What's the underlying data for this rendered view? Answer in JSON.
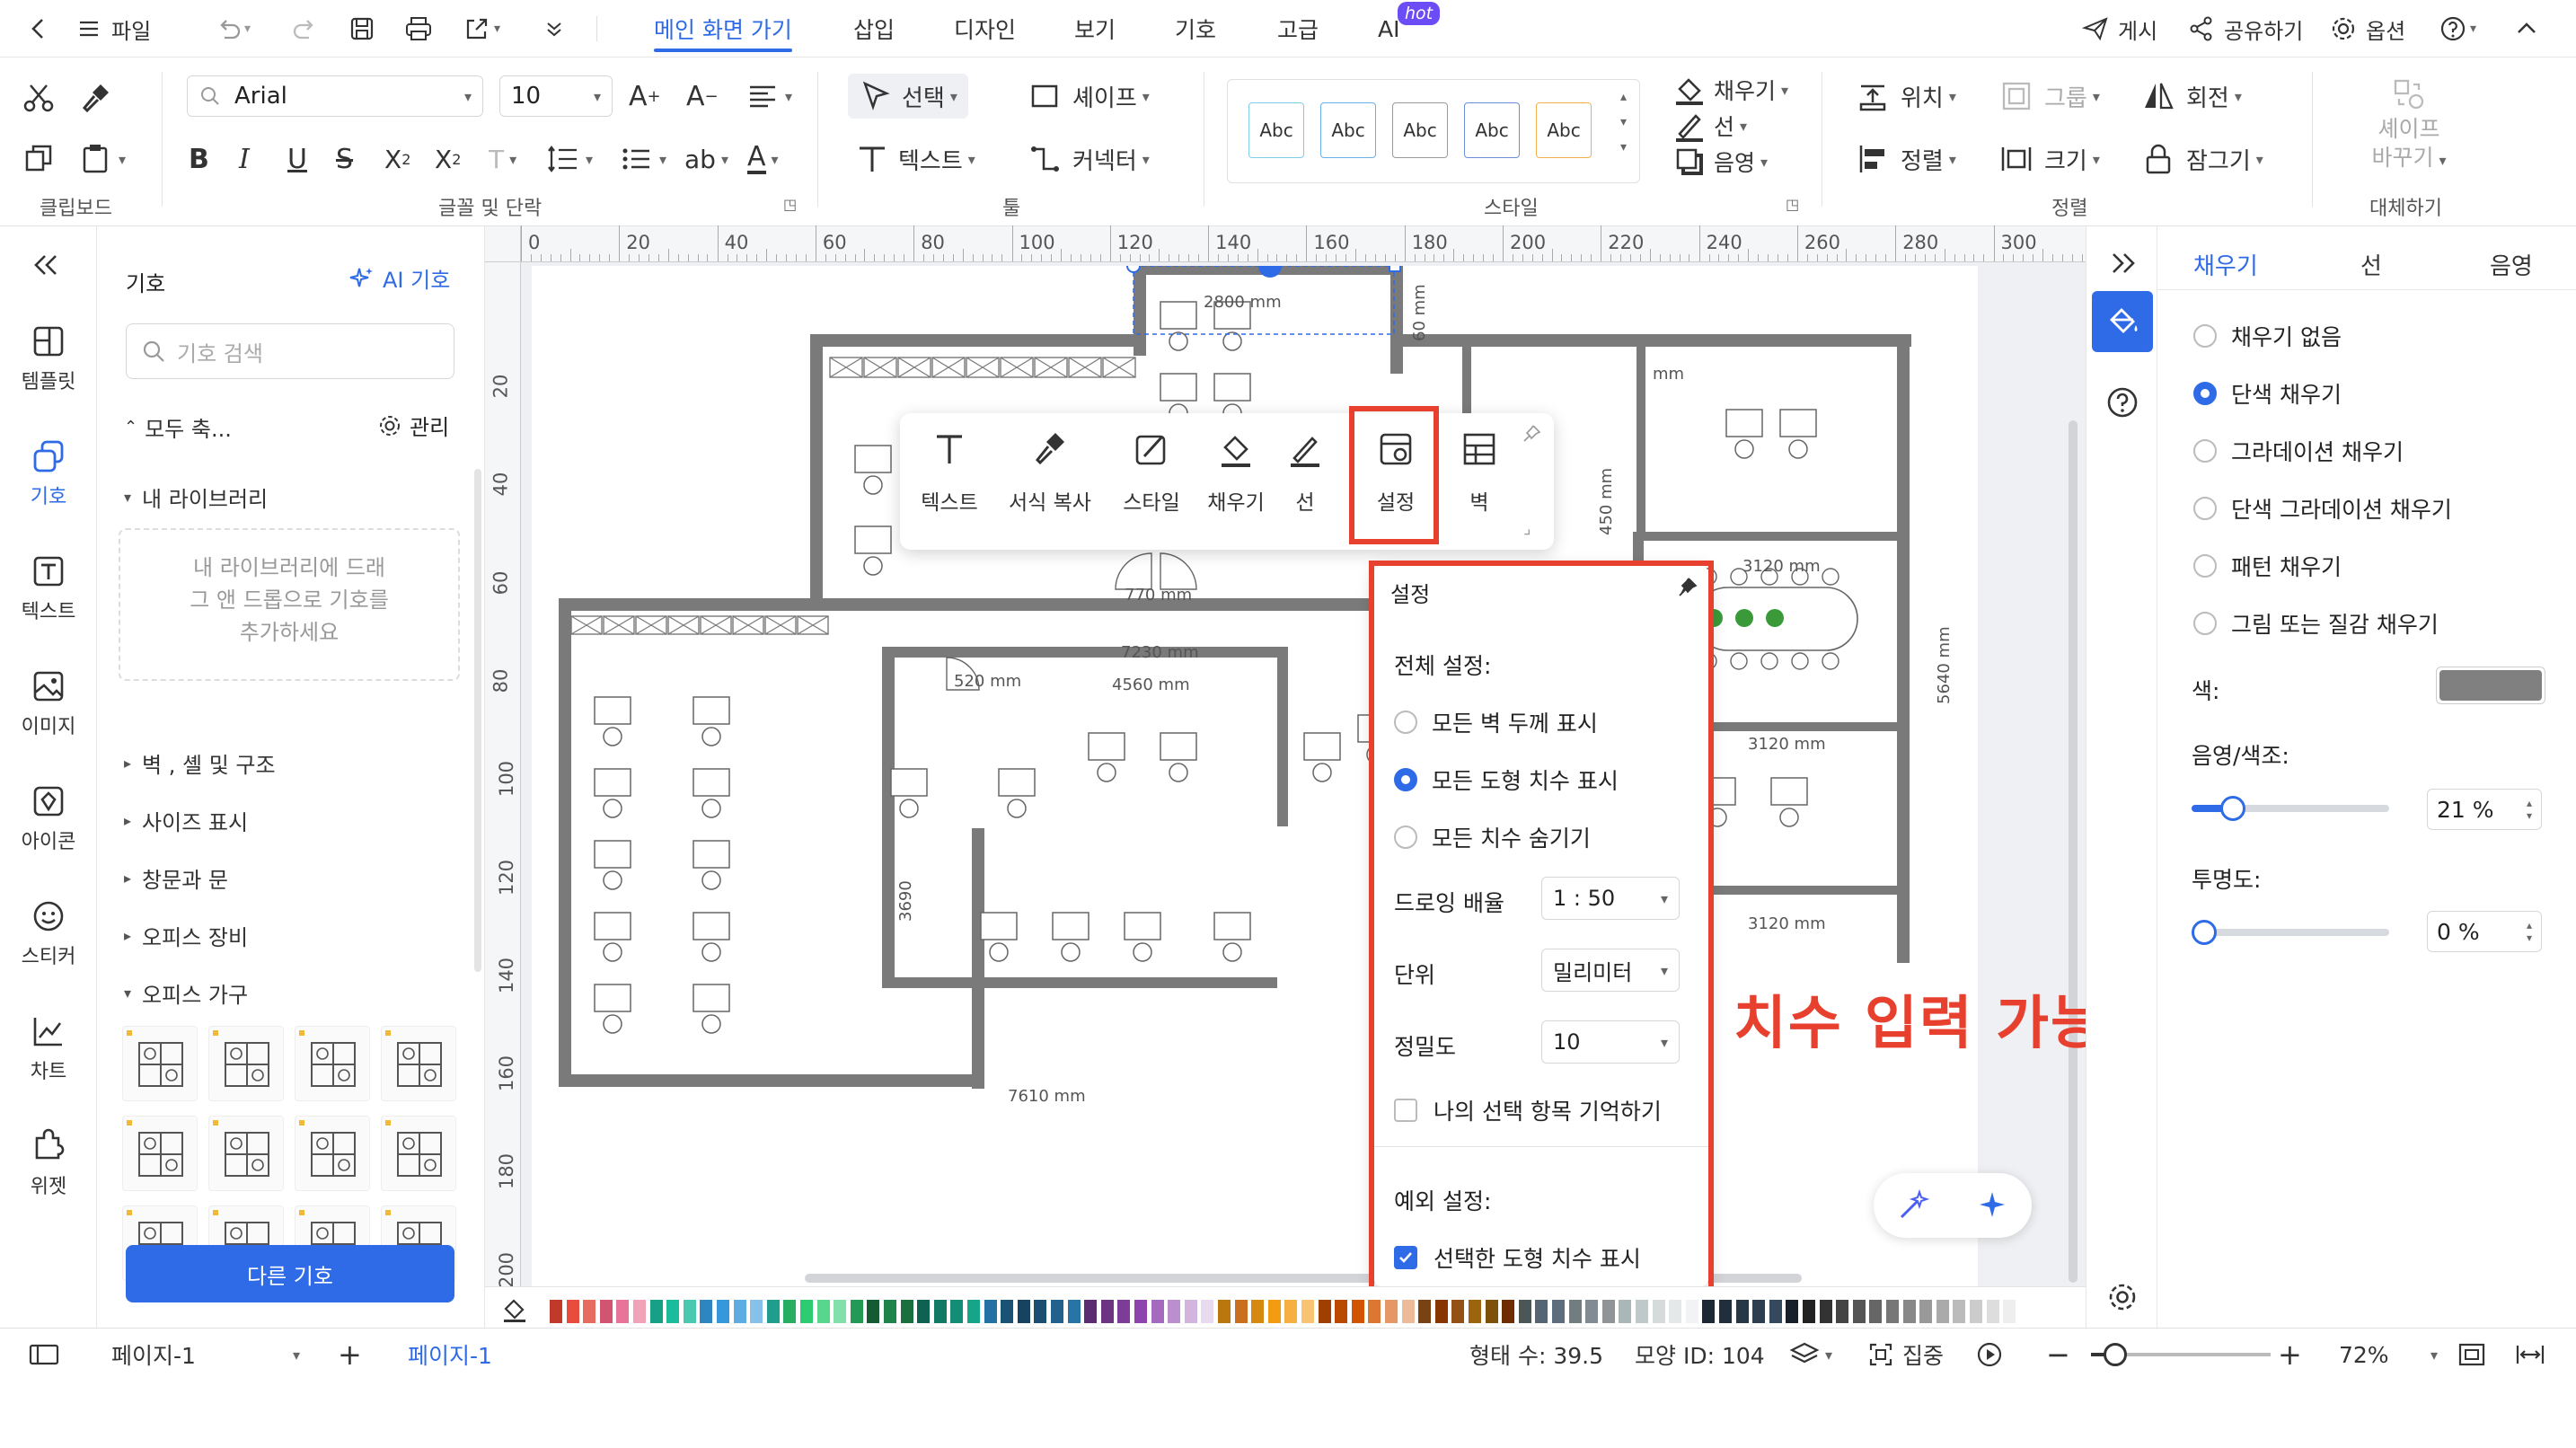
{
  "topbar": {
    "file_label": "파일",
    "tabs": [
      {
        "label": "메인 화면 가기",
        "active": true
      },
      {
        "label": "삽입"
      },
      {
        "label": "디자인"
      },
      {
        "label": "보기"
      },
      {
        "label": "기호"
      },
      {
        "label": "고급"
      },
      {
        "label": "AI"
      }
    ],
    "hot_badge": "hot",
    "post_label": "게시",
    "share_label": "공유하기",
    "options_label": "옵션"
  },
  "ribbon": {
    "font_name": "Arial",
    "font_size": "10",
    "select_label": "선택",
    "shape_label": "셰이프",
    "text_label": "텍스트",
    "connector_label": "커넥터",
    "fill_label": "채우기",
    "line_label": "선",
    "shadow_label": "음영",
    "position_label": "위치",
    "group_label": "그룹",
    "rotate_label": "회전",
    "align_label": "정렬",
    "size_label": "크기",
    "lock_label": "잠그기",
    "replace_shape_label": "셰이프 바꾸기",
    "style_samples": [
      "Abc",
      "Abc",
      "Abc",
      "Abc",
      "Abc"
    ],
    "style_colors": [
      "#7fcfe8",
      "#6ab0e6",
      "#9a9a9a",
      "#6a8fd8",
      "#f2b04a"
    ],
    "groups": {
      "clipboard": "클립보드",
      "font_para": "글꼴 및 단락",
      "tools": "툴",
      "style": "스타일",
      "arrange": "정렬",
      "replace": "대체하기"
    }
  },
  "leftnav": {
    "items": [
      {
        "label": "템플릿",
        "icon": "template-icon"
      },
      {
        "label": "기호",
        "icon": "symbol-icon",
        "active": true
      },
      {
        "label": "텍스트",
        "icon": "text-icon"
      },
      {
        "label": "이미지",
        "icon": "image-icon"
      },
      {
        "label": "아이콘",
        "icon": "icon-icon"
      },
      {
        "label": "스티커",
        "icon": "sticker-icon"
      },
      {
        "label": "차트",
        "icon": "chart-icon"
      },
      {
        "label": "위젯",
        "icon": "widget-icon"
      }
    ]
  },
  "symbols": {
    "title": "기호",
    "ai_symbols": "AI 기호",
    "search_placeholder": "기호 검색",
    "collapse_all": "모두 축...",
    "manage": "관리",
    "my_library": "내 라이브러리",
    "my_library_hint": "내 라이브러리에 드래그 앤 드롭으로 기호를 추가하세요",
    "categories": [
      "벽 , 셸 및 구조",
      "사이즈 표시",
      "창문과 문",
      "오피스 장비",
      "오피스 가구"
    ],
    "more_button": "다른 기호"
  },
  "ruler": {
    "top": [
      "0",
      "20",
      "40",
      "60",
      "80",
      "100",
      "120",
      "140",
      "160",
      "180",
      "200",
      "220",
      "240",
      "260",
      "280",
      "300"
    ],
    "left": [
      "20",
      "40",
      "60",
      "80",
      "100",
      "120",
      "140",
      "160",
      "180",
      "200"
    ]
  },
  "floorplan": {
    "dims": [
      "2800 mm",
      "770 mm",
      "7230 mm",
      "520 mm",
      "4560 mm",
      "3690",
      "7610 mm",
      "3120 mm",
      "3120 mm",
      "3120 mm",
      "5640 mm",
      "450 mm",
      "60 mm",
      "mm"
    ]
  },
  "floatbar": {
    "items": [
      "텍스트",
      "서식 복사",
      "스타일",
      "채우기",
      "선",
      "설정",
      "벽"
    ]
  },
  "settings": {
    "title": "설정",
    "global_heading": "전체 설정:",
    "options": [
      "모든 벽 두께 표시",
      "모든 도형 치수 표시",
      "모든 치수 숨기기"
    ],
    "selected_option": 1,
    "scale_label": "드로잉 배율",
    "scale_value": "1 : 50",
    "unit_label": "단위",
    "unit_value": "밀리미터",
    "precision_label": "정밀도",
    "precision_value": "10",
    "remember_label": "나의 선택 항목 기억하기",
    "exception_heading": "예외 설정:",
    "exception_label": "선택한 도형 치수 표시"
  },
  "annotation": "치수 입력 가능",
  "rightpanel": {
    "tabs": [
      "채우기",
      "선",
      "음영"
    ],
    "fill_options": [
      "채우기 없음",
      "단색 채우기",
      "그라데이션 채우기",
      "단색 그라데이션 채우기",
      "패턴 채우기",
      "그림 또는 질감 채우기"
    ],
    "selected_fill": 1,
    "color_label": "색:",
    "color_value": "#808080",
    "tint_label": "음영/색조:",
    "tint_value": "21 %",
    "tint_level": 21,
    "transparency_label": "투명도:",
    "transparency_value": "0 %",
    "transparency_level": 0
  },
  "statusbar": {
    "page_select": "페이지-1",
    "page_tab": "페이지-1",
    "shape_count": "형태 수: 39.5",
    "shape_id": "모양 ID: 104",
    "focus": "집중",
    "zoom": "72%"
  },
  "colors": {
    "accent": "#2f6be6",
    "highlight": "#e8402f",
    "wall": "#7a7a7a"
  }
}
